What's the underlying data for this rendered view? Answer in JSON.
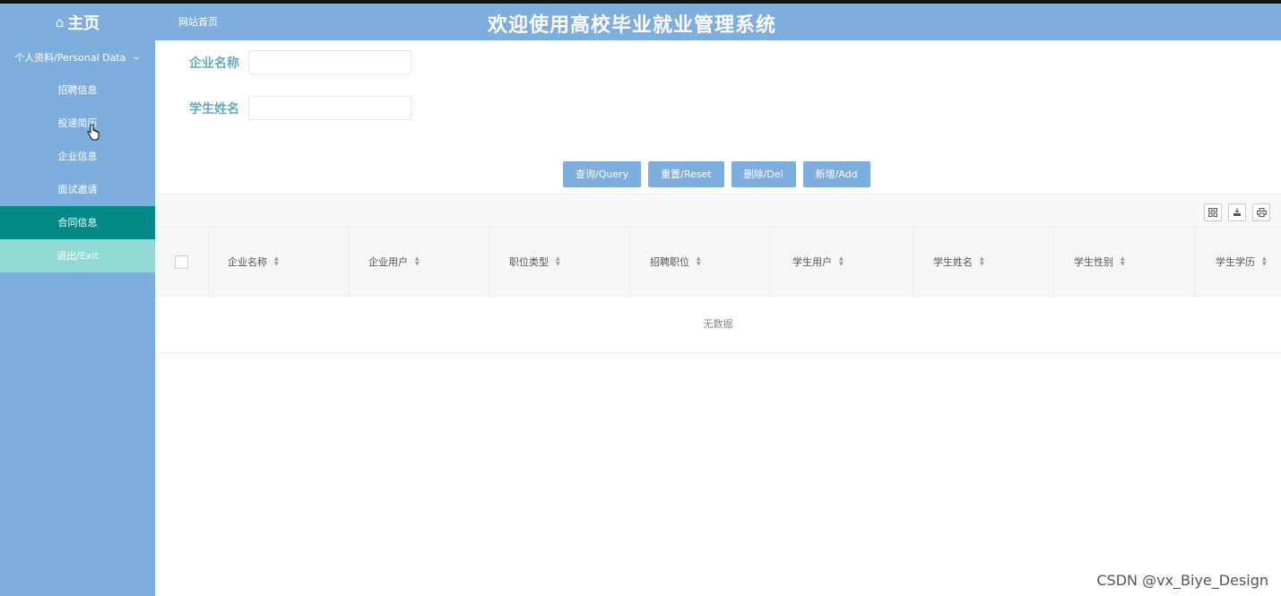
{
  "header": {
    "brand": "主页",
    "home_icon": "home-icon",
    "breadcrumb": "网站首页",
    "title": "欢迎使用高校毕业就业管理系统"
  },
  "sidebar": {
    "group": "个人资料/Personal Data",
    "items": [
      {
        "label": "招聘信息"
      },
      {
        "label": "投递简历"
      },
      {
        "label": "企业信息"
      },
      {
        "label": "面试邀请"
      },
      {
        "label": "合同信息",
        "active": true
      },
      {
        "label": "退出/Exit"
      }
    ]
  },
  "search": {
    "company_label": "企业名称",
    "company_value": "",
    "student_label": "学生姓名",
    "student_value": ""
  },
  "buttons": {
    "query": "查询/Query",
    "reset": "重置/Reset",
    "delete": "删除/Del",
    "add": "新增/Add"
  },
  "toolbar": {
    "icons": [
      "grid-columns-icon",
      "export-icon",
      "print-icon"
    ]
  },
  "table": {
    "columns": [
      "企业名称",
      "企业用户",
      "职位类型",
      "招聘职位",
      "学生用户",
      "学生姓名",
      "学生性别",
      "学生学历"
    ],
    "empty_text": "无数据"
  },
  "watermark": "CSDN @vx_Biye_Design",
  "colors": {
    "header": "#7eaedd",
    "active_item": "#028a87",
    "exit_item": "#92dbd4",
    "label": "#66aabb"
  }
}
